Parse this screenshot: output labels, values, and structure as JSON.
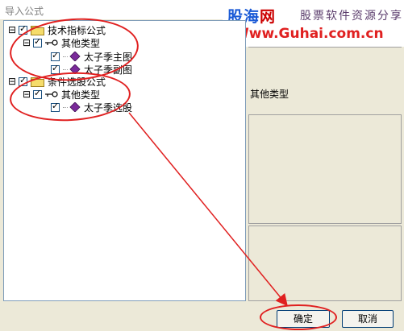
{
  "window": {
    "title": "导入公式"
  },
  "banner": {
    "logo_a": "股海",
    "logo_b": "网",
    "slogan": "股票软件资源分享",
    "url": "Www.Guhai.com.cn"
  },
  "tree": {
    "groups": [
      {
        "label": "技术指标公式",
        "expander": "⊟",
        "checked": true,
        "children": [
          {
            "label": "其他类型",
            "expander": "⊟",
            "checked": true,
            "items": [
              {
                "label": "太子季主图",
                "checked": true
              },
              {
                "label": "太子季副图",
                "checked": true
              }
            ]
          }
        ]
      },
      {
        "label": "条件选股公式",
        "expander": "⊟",
        "checked": true,
        "children": [
          {
            "label": "其他类型",
            "expander": "⊟",
            "checked": true,
            "items": [
              {
                "label": "太子季选股",
                "checked": true
              }
            ]
          }
        ]
      }
    ]
  },
  "side": {
    "type_label": "其他类型"
  },
  "buttons": {
    "ok": "确定",
    "cancel": "取消"
  },
  "colors": {
    "annotation": "#e02020",
    "folder": "#f5dc6b",
    "gem": "#7a2a9a"
  },
  "icons": [
    "folder-icon",
    "key-icon",
    "gem-icon",
    "checkbox-check-icon",
    "collapse-icon"
  ]
}
